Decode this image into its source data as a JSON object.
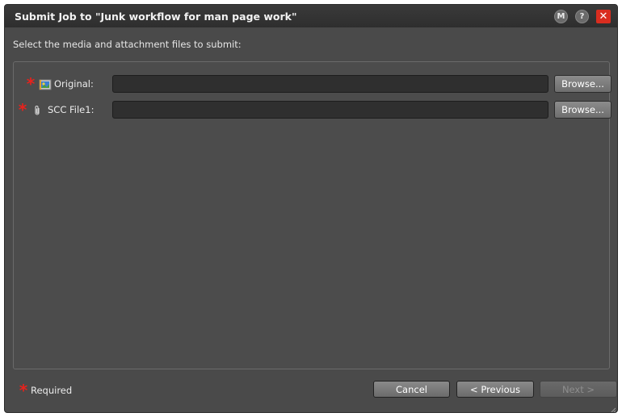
{
  "window": {
    "title": "Submit Job to \"Junk workflow for man page work\"",
    "controls": {
      "m_label": "M",
      "help_label": "?",
      "close_label": "✕"
    }
  },
  "instruction": "Select the media and attachment files to submit:",
  "fields": [
    {
      "required_mark": "*",
      "icon": "media-image-icon",
      "label": "Original:",
      "value": "",
      "browse_label": "Browse..."
    },
    {
      "required_mark": "*",
      "icon": "paperclip-icon",
      "label": "SCC File1:",
      "value": "",
      "browse_label": "Browse..."
    }
  ],
  "footer": {
    "required_mark": "*",
    "required_label": "Required",
    "cancel_label": "Cancel",
    "previous_label": "< Previous",
    "next_label": "Next >"
  },
  "colors": {
    "required": "#e8221c",
    "close": "#d92d1f",
    "background": "#4a4a4a"
  }
}
